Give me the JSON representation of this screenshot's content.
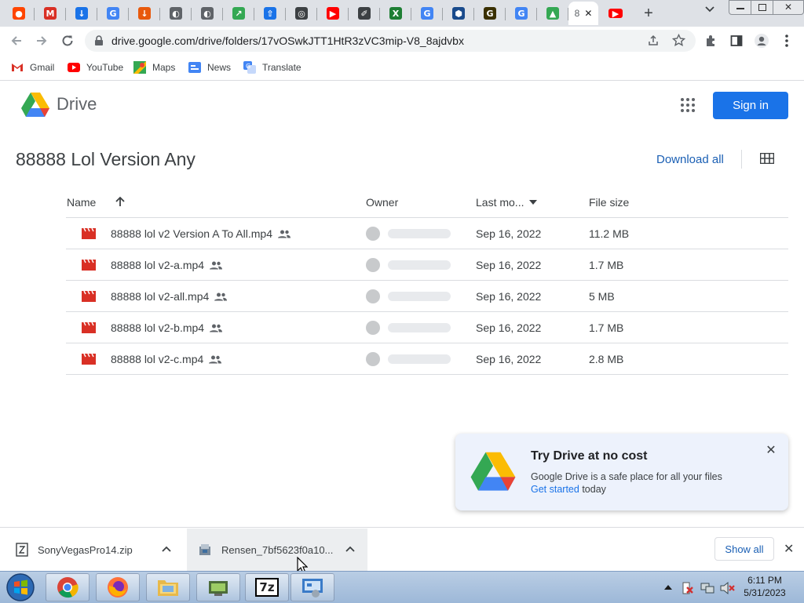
{
  "browser": {
    "tabs": [
      {
        "icon": "reddit-icon",
        "color": "#ff4500",
        "glyph": "●"
      },
      {
        "icon": "gmail-icon",
        "color": "#d93025",
        "glyph": "M"
      },
      {
        "icon": "download-icon",
        "color": "#1a73e8",
        "glyph": "↓"
      },
      {
        "icon": "google-icon",
        "color": "#4285f4",
        "glyph": "G"
      },
      {
        "icon": "download-orange-icon",
        "color": "#e8590c",
        "glyph": "↓"
      },
      {
        "icon": "globe-icon",
        "color": "#5f6368",
        "glyph": "◐"
      },
      {
        "icon": "globe-icon",
        "color": "#5f6368",
        "glyph": "◐"
      },
      {
        "icon": "share-green-icon",
        "color": "#34a853",
        "glyph": "↗"
      },
      {
        "icon": "upload-icon",
        "color": "#1a73e8",
        "glyph": "⇧"
      },
      {
        "icon": "chrome-icon",
        "color": "#3c4043",
        "glyph": "◎"
      },
      {
        "icon": "youtube-icon",
        "color": "#ff0000",
        "glyph": "▶"
      },
      {
        "icon": "tool-icon",
        "color": "#3c4043",
        "glyph": "✐"
      },
      {
        "icon": "excel-icon",
        "color": "#1e7e34",
        "glyph": "X"
      },
      {
        "icon": "google-icon",
        "color": "#4285f4",
        "glyph": "G"
      },
      {
        "icon": "shield-icon",
        "color": "#1a4b8c",
        "glyph": "⬢"
      },
      {
        "icon": "g-logo-dark-icon",
        "color": "#3a3000",
        "glyph": "G"
      },
      {
        "icon": "google-icon",
        "color": "#4285f4",
        "glyph": "G"
      },
      {
        "icon": "drive-icon",
        "color": "#34a853",
        "glyph": "▲"
      }
    ],
    "active_tab_label": "8",
    "after_active_tab": {
      "icon": "youtube-icon",
      "color": "#ff0000",
      "glyph": "▶"
    },
    "new_tab_label": "+",
    "url": "drive.google.com/drive/folders/17vOSwkJTT1HtR3zVC3mip-V8_8ajdvbx",
    "bookmarks": [
      {
        "label": "Gmail",
        "icon": "gmail-icon"
      },
      {
        "label": "YouTube",
        "icon": "youtube-icon"
      },
      {
        "label": "Maps",
        "icon": "maps-icon"
      },
      {
        "label": "News",
        "icon": "news-icon"
      },
      {
        "label": "Translate",
        "icon": "translate-icon"
      }
    ]
  },
  "drive": {
    "brand": "Drive",
    "signin_label": "Sign in",
    "folder_title": "88888 Lol Version Any",
    "download_all_label": "Download all",
    "columns": {
      "name": "Name",
      "owner": "Owner",
      "modified": "Last mo...",
      "size": "File size"
    },
    "files": [
      {
        "name": "88888 lol v2 Version A To All.mp4",
        "modified": "Sep 16, 2022",
        "size": "11.2 MB"
      },
      {
        "name": "88888 lol v2-a.mp4",
        "modified": "Sep 16, 2022",
        "size": "1.7 MB"
      },
      {
        "name": "88888 lol v2-all.mp4",
        "modified": "Sep 16, 2022",
        "size": "5 MB"
      },
      {
        "name": "88888 lol v2-b.mp4",
        "modified": "Sep 16, 2022",
        "size": "1.7 MB"
      },
      {
        "name": "88888 lol v2-c.mp4",
        "modified": "Sep 16, 2022",
        "size": "2.8 MB"
      }
    ],
    "promo": {
      "title": "Try Drive at no cost",
      "text": "Google Drive is a safe place for all your files",
      "link": "Get started",
      "tail": " today"
    }
  },
  "downloads": {
    "items": [
      {
        "name": "SonyVegasPro14.zip"
      },
      {
        "name": "Rensen_7bf5623f0a10..."
      }
    ],
    "show_all_label": "Show all"
  },
  "taskbar": {
    "time": "6:11 PM",
    "date": "5/31/2023",
    "apps": [
      "chrome-icon",
      "firefox-icon",
      "explorer-icon",
      "device-manager-icon",
      "sevenzip-icon",
      "control-panel-icon"
    ],
    "sevenzip_label": "7z"
  },
  "colors": {
    "accent": "#1a73e8",
    "file_red": "#d93025"
  }
}
